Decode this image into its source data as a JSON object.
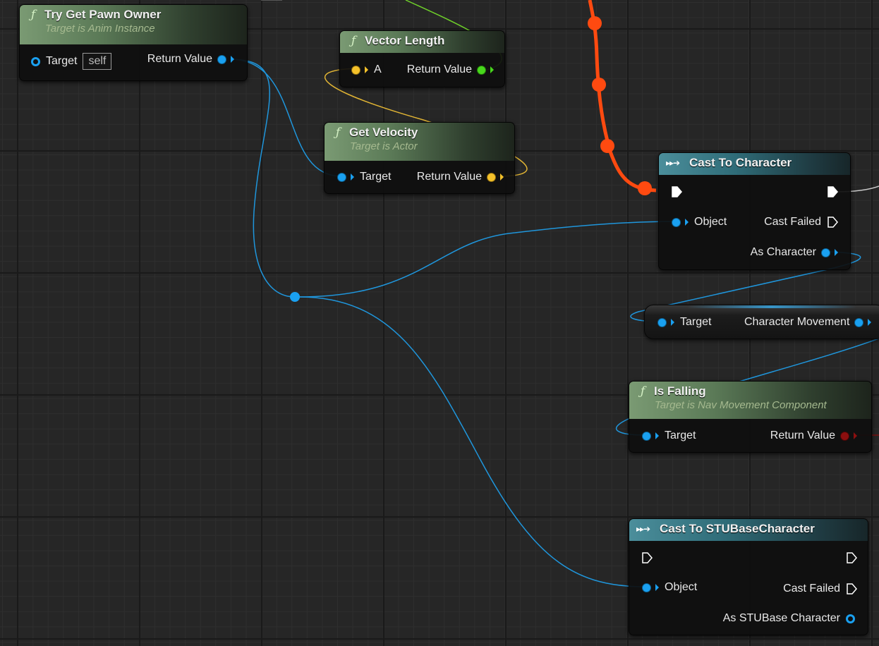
{
  "nodes": {
    "try_get_pawn_owner": {
      "title": "Try Get Pawn Owner",
      "subtitle": "Target is Anim Instance",
      "target_label": "Target",
      "target_default": "self",
      "return_label": "Return Value"
    },
    "vector_length": {
      "title": "Vector Length",
      "input_label": "A",
      "return_label": "Return Value"
    },
    "get_velocity": {
      "title": "Get Velocity",
      "subtitle": "Target is Actor",
      "target_label": "Target",
      "return_label": "Return Value"
    },
    "cast_to_character": {
      "title": "Cast To Character",
      "object_label": "Object",
      "cast_failed_label": "Cast Failed",
      "as_label": "As Character"
    },
    "character_movement": {
      "target_label": "Target",
      "output_label": "Character Movement"
    },
    "is_falling": {
      "title": "Is Falling",
      "subtitle": "Target is Nav Movement Component",
      "target_label": "Target",
      "return_label": "Return Value"
    },
    "cast_to_stubase": {
      "title": "Cast To STUBaseCharacter",
      "object_label": "Object",
      "cast_failed_label": "Cast Failed",
      "as_label": "As STUBase Character"
    }
  },
  "colors": {
    "object_pin": "#1aa0f0",
    "vector_pin": "#f4c12a",
    "float_pin": "#48d81c",
    "bool_pin": "#8c0f0f",
    "exec_active_wire": "#ff4a10",
    "exec_pin": "#ffffff",
    "function_header": "#6f8f69",
    "cast_header": "#3f8794"
  },
  "icons": {
    "function": "function-f-icon",
    "cast": "cast-arrow-icon",
    "exec": "exec-pin-icon"
  }
}
